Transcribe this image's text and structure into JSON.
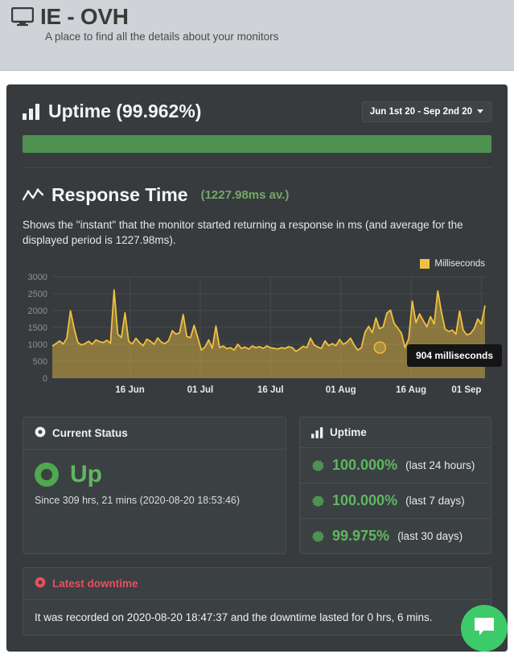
{
  "header": {
    "icon": "monitor-icon",
    "title": "IE - OVH",
    "subtitle": "A place to find all the details about your monitors"
  },
  "uptime_section": {
    "icon": "bar-chart-icon",
    "title": "Uptime (99.962%)",
    "date_range_label": "Jun 1st 20 - Sep 2nd 20",
    "bar_percent": "100",
    "bar_color": "#4f9150"
  },
  "response_section": {
    "icon": "trend-line-icon",
    "title": "Response Time",
    "average_label": "(1227.98ms av.)",
    "description": "Shows the \"instant\" that the monitor started returning a response in ms (and average for the displayed period is 1227.98ms).",
    "tooltip": "904 milliseconds"
  },
  "chart_data": {
    "type": "area",
    "title": "Response Time",
    "xlabel": "",
    "ylabel": "Milliseconds",
    "ylim": [
      0,
      3000
    ],
    "yticks": [
      0,
      500,
      1000,
      1500,
      2000,
      2500,
      3000
    ],
    "ytick_labels": [
      "0",
      "500",
      "1000",
      "1500",
      "2000",
      "2500",
      "3000"
    ],
    "xtick_labels": [
      "16 Jun",
      "01 Jul",
      "16 Jul",
      "01 Aug",
      "16 Aug",
      "01 Sep"
    ],
    "xtick_positions": [
      0.1795,
      0.3419,
      0.5043,
      0.6667,
      0.8291,
      0.9915
    ],
    "legend": [
      "Milliseconds"
    ],
    "legend_position": "top-right",
    "grid": true,
    "line_color": "#f0c040",
    "fill_color": "rgba(240,192,64,0.45)",
    "annotation": {
      "label": "904 milliseconds",
      "value": 904,
      "x_fraction": 0.7571
    },
    "series": [
      {
        "name": "Milliseconds",
        "values": [
          950,
          1020,
          1100,
          1010,
          1180,
          1990,
          1480,
          1060,
          980,
          1020,
          1090,
          1000,
          1130,
          1080,
          1050,
          1120,
          1030,
          2610,
          1300,
          1200,
          1930,
          1090,
          1010,
          1180,
          1050,
          960,
          1150,
          1090,
          1000,
          1190,
          1060,
          1020,
          1110,
          1400,
          1300,
          1340,
          1880,
          1230,
          1200,
          1560,
          1200,
          830,
          920,
          1130,
          880,
          1540,
          900,
          950,
          870,
          900,
          830,
          1000,
          880,
          920,
          860,
          950,
          900,
          930,
          880,
          950,
          900,
          880,
          860,
          900,
          880,
          930,
          900,
          790,
          860,
          940,
          900,
          1180,
          980,
          920,
          880,
          1100,
          960,
          1020,
          960,
          1140,
          1000,
          1060,
          1180,
          980,
          830,
          900,
          1360,
          1530,
          1340,
          1780,
          1460,
          1520,
          1920,
          2010,
          1620,
          1480,
          1330,
          904,
          1160,
          2280,
          1640,
          1900,
          1700,
          1520,
          1820,
          1600,
          2580,
          1960,
          1450,
          1380,
          1420,
          1300,
          1980,
          1420,
          1280,
          1320,
          1460,
          1750,
          1600,
          2150
        ]
      }
    ]
  },
  "current_status_panel": {
    "icon": "circle-dot-icon",
    "title": "Current Status",
    "status_icon": "status-up-donut-icon",
    "status": "Up",
    "since": "Since 309 hrs, 21 mins (2020-08-20 18:53:46)"
  },
  "uptime_panel": {
    "icon": "bar-chart-icon",
    "title": "Uptime",
    "rows": [
      {
        "icon": "badge-icon",
        "percent": "100.000%",
        "period": "(last 24 hours)"
      },
      {
        "icon": "badge-icon",
        "percent": "100.000%",
        "period": "(last 7 days)"
      },
      {
        "icon": "badge-icon",
        "percent": "99.975%",
        "period": "(last 30 days)"
      }
    ]
  },
  "downtime_panel": {
    "icon": "circle-dot-icon",
    "title": "Latest downtime",
    "text": "It was recorded on 2020-08-20 18:47:37 and the downtime lasted for 0 hrs, 6 mins."
  },
  "chat_widget": {
    "icon": "chat-bubble-icon",
    "color": "#3ccb68"
  }
}
